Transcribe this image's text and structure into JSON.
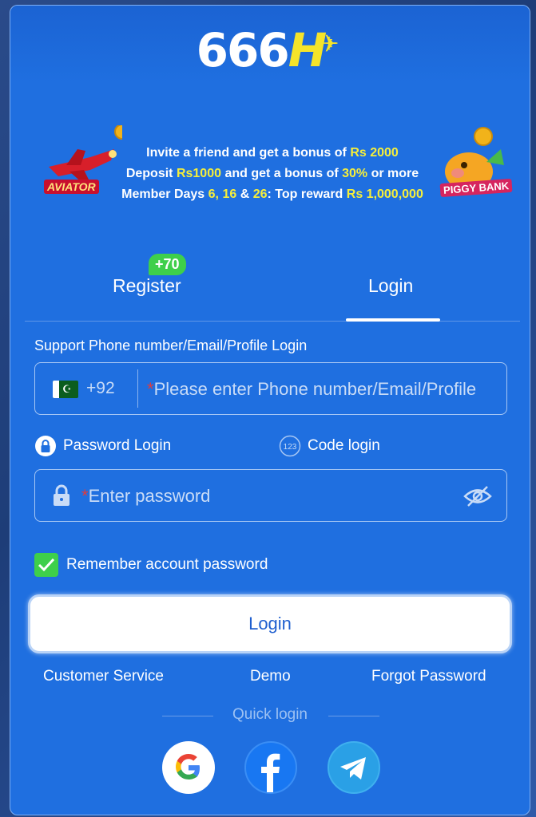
{
  "logo": {
    "text_main": "666",
    "text_h": "H"
  },
  "promo": {
    "line1": {
      "pre": "Invite a friend and get a bonus of ",
      "hl": "Rs 2000"
    },
    "line2": {
      "pre": "Deposit ",
      "hl1": "Rs1000",
      "mid": " and get a bonus of ",
      "hl2": "30%",
      "post": " or more"
    },
    "line3": {
      "pre": "Member Days ",
      "hl1": "6, 16",
      "mid1": " & ",
      "hl2": "26",
      "mid2": ": Top reward ",
      "hl3": "Rs 1,000,000"
    },
    "left_game": "AVIATOR",
    "right_game": "PIGGY BANK"
  },
  "tabs": {
    "register": "Register",
    "register_badge": "+70",
    "login": "Login",
    "active": "login"
  },
  "form": {
    "support_label": "Support Phone number/Email/Profile Login",
    "country_code": "+92",
    "country_flag_icon": "pakistan-flag-icon",
    "phone_placeholder": "Please enter Phone number/Email/Profile",
    "required_mark": "*",
    "password_login_label": "Password Login",
    "code_login_label": "Code login",
    "code_login_icon_text": "123",
    "password_placeholder": "Enter password",
    "remember_label": "Remember account password",
    "remember_checked": true
  },
  "actions": {
    "login_button": "Login",
    "customer_service": "Customer Service",
    "demo": "Demo",
    "forgot_password": "Forgot Password"
  },
  "quick_login": {
    "label": "Quick login",
    "providers": [
      "google-icon",
      "facebook-icon",
      "telegram-icon"
    ]
  },
  "colors": {
    "card_bg": "#1f6fe0",
    "highlight": "#f6ef3a",
    "checkbox": "#3ecf4b",
    "required": "#e23b3b"
  }
}
